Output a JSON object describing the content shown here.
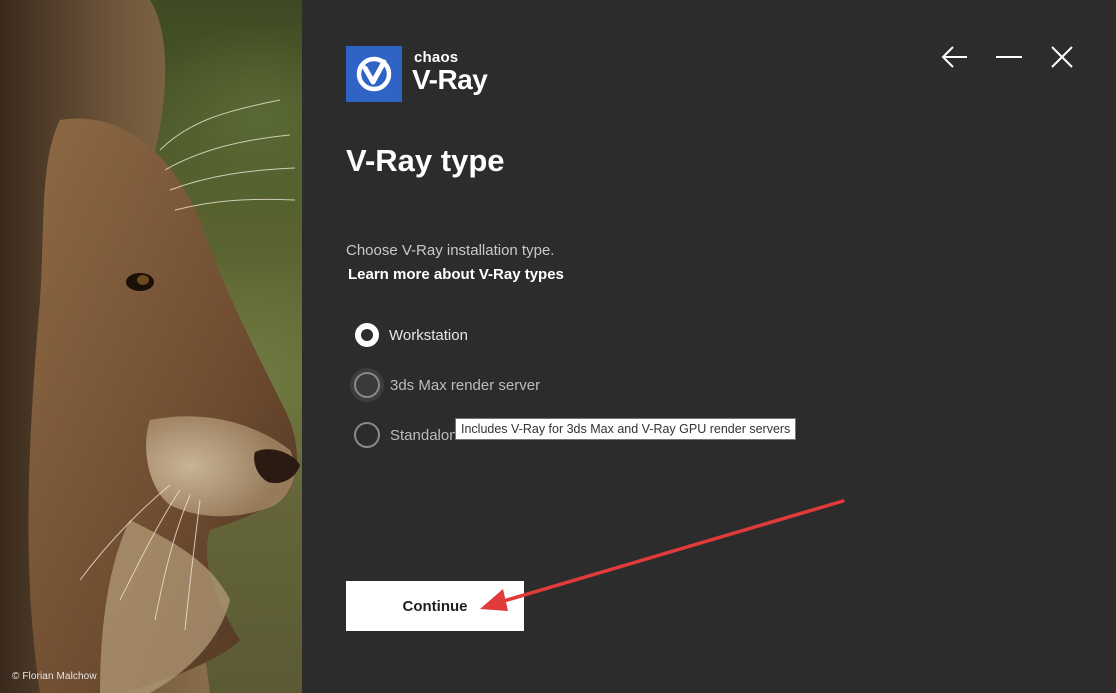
{
  "photo": {
    "credit": "© Florian Malchow"
  },
  "logo": {
    "brand": "chaos",
    "product": "V-Ray"
  },
  "window_controls": {
    "icons": [
      "back-arrow-icon",
      "minimize-icon",
      "close-icon"
    ]
  },
  "page": {
    "title": "V-Ray type",
    "subtitle": "Choose V-Ray installation type.",
    "learn_more": "Learn more about V-Ray types"
  },
  "options": [
    {
      "label": "Workstation",
      "selected": true
    },
    {
      "label": "3ds Max render server",
      "selected": false
    },
    {
      "label": "Standalone render server",
      "selected": false
    }
  ],
  "tooltip": "Includes V-Ray for 3ds Max and V-Ray GPU render servers",
  "continue_label": "Continue",
  "colors": {
    "accent_blue": "#2f63c5",
    "panel_bg": "#2c2c2c",
    "annotation_arrow": "#e03a3a"
  }
}
